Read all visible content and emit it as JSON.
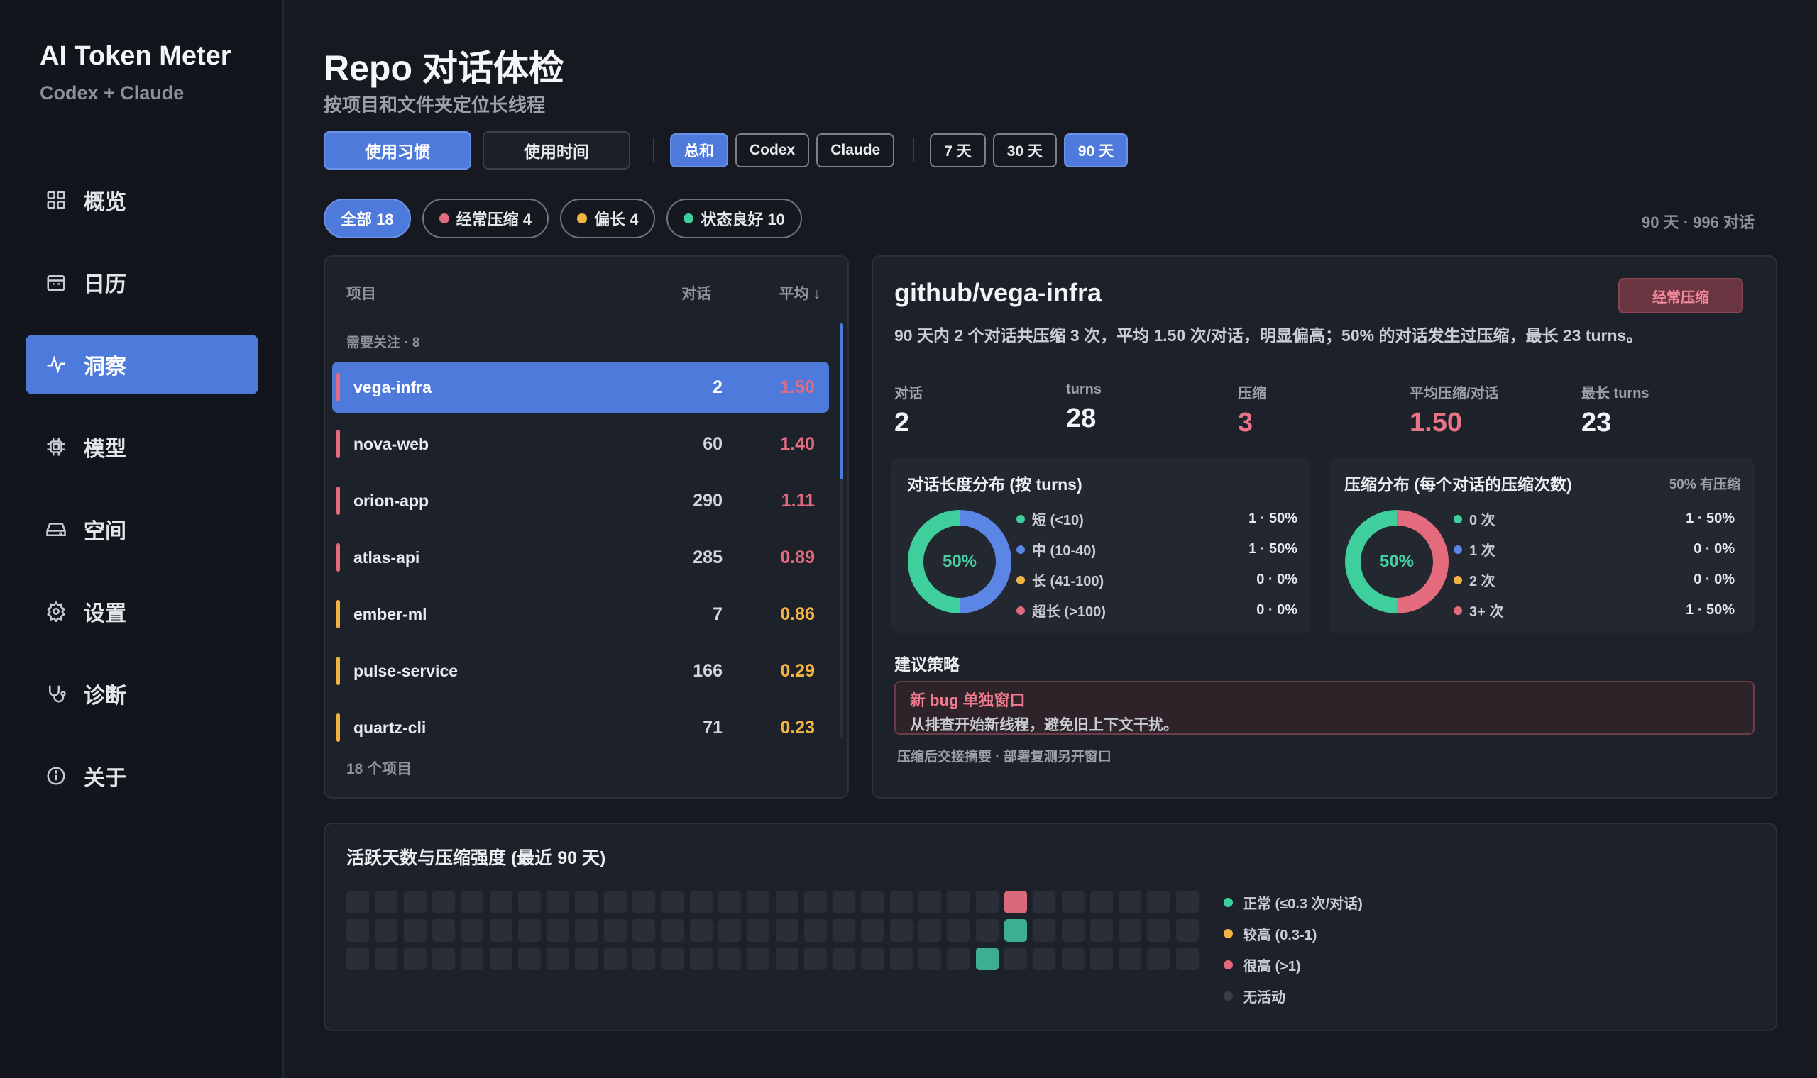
{
  "app": {
    "title": "AI Token Meter",
    "subtitle": "Codex + Claude"
  },
  "nav": [
    {
      "label": "概览",
      "icon": "grid-icon"
    },
    {
      "label": "日历",
      "icon": "calendar-icon"
    },
    {
      "label": "洞察",
      "icon": "activity-icon",
      "active": true
    },
    {
      "label": "模型",
      "icon": "chip-icon"
    },
    {
      "label": "空间",
      "icon": "drive-icon"
    },
    {
      "label": "设置",
      "icon": "gear-icon"
    },
    {
      "label": "诊断",
      "icon": "stethoscope-icon"
    },
    {
      "label": "关于",
      "icon": "info-icon"
    }
  ],
  "header": {
    "title": "Repo 对话体检",
    "subtitle": "按项目和文件夹定位长线程"
  },
  "toolbar": {
    "view": [
      "使用习惯",
      "使用时间"
    ],
    "source": [
      "总和",
      "Codex",
      "Claude"
    ],
    "range": [
      "7 天",
      "30 天",
      "90 天"
    ]
  },
  "filters": [
    {
      "label": "全部 18",
      "active": true
    },
    {
      "label": "经常压缩 4",
      "dot": "red"
    },
    {
      "label": "偏长 4",
      "dot": "amber"
    },
    {
      "label": "状态良好 10",
      "dot": "green"
    }
  ],
  "range_info": "90 天 · 996 对话",
  "list": {
    "headers": {
      "project": "项目",
      "count": "对话",
      "avg": "平均 ↓"
    },
    "group_label": "需要关注 · 8",
    "rows": [
      {
        "name": "vega-infra",
        "count": "2",
        "avg": "1.50",
        "level": "red",
        "selected": true
      },
      {
        "name": "nova-web",
        "count": "60",
        "avg": "1.40",
        "level": "red"
      },
      {
        "name": "orion-app",
        "count": "290",
        "avg": "1.11",
        "level": "red"
      },
      {
        "name": "atlas-api",
        "count": "285",
        "avg": "0.89",
        "level": "red"
      },
      {
        "name": "ember-ml",
        "count": "7",
        "avg": "0.86",
        "level": "amber"
      },
      {
        "name": "pulse-service",
        "count": "166",
        "avg": "0.29",
        "level": "amber"
      },
      {
        "name": "quartz-cli",
        "count": "71",
        "avg": "0.23",
        "level": "amber"
      }
    ],
    "footer": "18 个项目"
  },
  "detail": {
    "title": "github/vega-infra",
    "badge": "经常压缩",
    "summary": "90 天内 2 个对话共压缩 3 次，平均 1.50 次/对话，明显偏高；50% 的对话发生过压缩，最长 23 turns。",
    "stats": [
      {
        "label": "对话",
        "value": "2"
      },
      {
        "label": "turns",
        "value": "28"
      },
      {
        "label": "压缩",
        "value": "3",
        "highlight": true
      },
      {
        "label": "平均压缩/对话",
        "value": "1.50",
        "highlight": true
      },
      {
        "label": "最长 turns",
        "value": "23"
      }
    ],
    "length_dist": {
      "title": "对话长度分布 (按 turns)",
      "center": "50%",
      "items": [
        {
          "label": "短 (<10)",
          "value": "1 · 50%",
          "color": "#3fcf9d",
          "frac": 0.5
        },
        {
          "label": "中 (10-40)",
          "value": "1 · 50%",
          "color": "#5b86e5",
          "frac": 0.5
        },
        {
          "label": "长 (41-100)",
          "value": "0 · 0%",
          "color": "#f1b443",
          "frac": 0
        },
        {
          "label": "超长 (>100)",
          "value": "0 · 0%",
          "color": "#e46b7d",
          "frac": 0
        }
      ]
    },
    "compress_dist": {
      "title": "压缩分布 (每个对话的压缩次数)",
      "note": "50% 有压缩",
      "center": "50%",
      "items": [
        {
          "label": "0 次",
          "value": "1 · 50%",
          "color": "#3fcf9d",
          "frac": 0.5
        },
        {
          "label": "1 次",
          "value": "0 · 0%",
          "color": "#5b86e5",
          "frac": 0
        },
        {
          "label": "2 次",
          "value": "0 · 0%",
          "color": "#f1b443",
          "frac": 0
        },
        {
          "label": "3+ 次",
          "value": "1 · 50%",
          "color": "#e46b7d",
          "frac": 0.5
        }
      ]
    },
    "strategy": {
      "title": "建议策略",
      "item_title": "新 bug 单独窗口",
      "item_desc": "从排查开始新线程，避免旧上下文干扰。",
      "footer": "压缩后交接摘要  ·  部署复测另开窗口"
    }
  },
  "heatmap": {
    "title": "活跃天数与压缩强度 (最近 90 天)",
    "rows": 3,
    "cols": 30,
    "active": [
      {
        "row": 0,
        "col": 23,
        "level": "red"
      },
      {
        "row": 1,
        "col": 23,
        "level": "green"
      },
      {
        "row": 2,
        "col": 22,
        "level": "green"
      }
    ],
    "legend": [
      {
        "label": "正常 (≤0.3 次/对话)",
        "dot": "green"
      },
      {
        "label": "较高 (0.3-1)",
        "dot": "amber"
      },
      {
        "label": "很高 (>1)",
        "dot": "red"
      },
      {
        "label": "无活动",
        "dot": "gray"
      }
    ]
  }
}
